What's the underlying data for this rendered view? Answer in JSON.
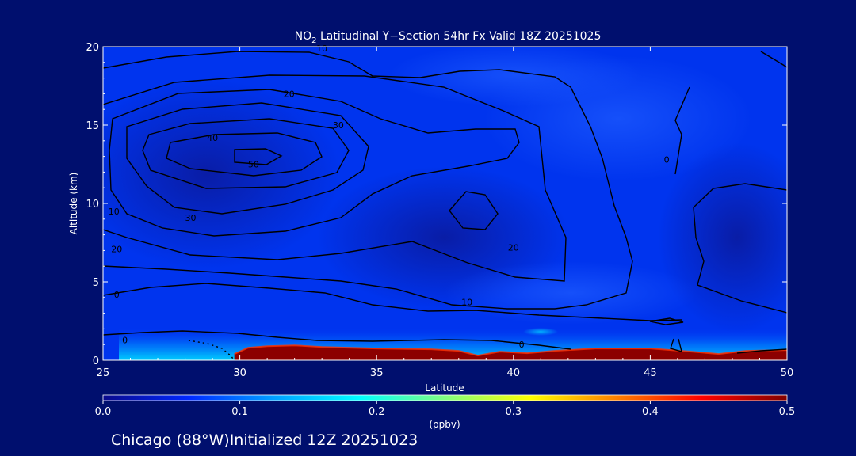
{
  "chart_data": {
    "type": "heatmap",
    "title": {
      "prefix": "NO",
      "subscript": "2",
      "suffix": " Latitudinal Y−Section 54hr  Fx Valid 18Z 20251025"
    },
    "xlabel": "Latitude",
    "ylabel": "Altitude (km)",
    "xlim": [
      25,
      50
    ],
    "ylim": [
      0,
      20
    ],
    "x_ticks": [
      25,
      30,
      35,
      40,
      45,
      50
    ],
    "y_ticks": [
      0,
      5,
      10,
      15,
      20
    ],
    "colorbar": {
      "min": 0.0,
      "max": 0.5,
      "ticks": [
        "0.0",
        "0.1",
        "0.2",
        "0.3",
        "0.4",
        "0.5"
      ],
      "units": "(ppbv)",
      "colors": [
        "#0a0a8c",
        "#0028ff",
        "#00a0ff",
        "#00ffff",
        "#80ff80",
        "#ffff00",
        "#ff8000",
        "#ff0000",
        "#800000"
      ]
    },
    "background_field": "mostly 0.02-0.08 ppbv (blue) aloft; high values (>0.5 ppbv, dark red) in a shallow layer 0-1 km between latitude 30 and 50",
    "surface_layer": [
      {
        "lat": 29.8,
        "top_km": 0.4
      },
      {
        "lat": 30.3,
        "top_km": 0.8
      },
      {
        "lat": 31.0,
        "top_km": 0.9
      },
      {
        "lat": 32.0,
        "top_km": 0.95
      },
      {
        "lat": 33.0,
        "top_km": 0.85
      },
      {
        "lat": 35.0,
        "top_km": 0.75
      },
      {
        "lat": 37.0,
        "top_km": 0.7
      },
      {
        "lat": 38.0,
        "top_km": 0.6
      },
      {
        "lat": 38.7,
        "top_km": 0.3
      },
      {
        "lat": 39.5,
        "top_km": 0.55
      },
      {
        "lat": 40.5,
        "top_km": 0.45
      },
      {
        "lat": 41.5,
        "top_km": 0.6
      },
      {
        "lat": 43.0,
        "top_km": 0.75
      },
      {
        "lat": 45.0,
        "top_km": 0.75
      },
      {
        "lat": 46.5,
        "top_km": 0.55
      },
      {
        "lat": 47.5,
        "top_km": 0.4
      },
      {
        "lat": 48.5,
        "top_km": 0.6
      },
      {
        "lat": 50.0,
        "top_km": 0.65
      }
    ],
    "contour_labels": [
      {
        "text": "10",
        "lat": 33.0,
        "alt": 19.9
      },
      {
        "text": "20",
        "lat": 31.8,
        "alt": 17.0
      },
      {
        "text": "30",
        "lat": 33.6,
        "alt": 15.0
      },
      {
        "text": "40",
        "lat": 29.0,
        "alt": 14.2
      },
      {
        "text": "50",
        "lat": 30.5,
        "alt": 12.5
      },
      {
        "text": "10",
        "lat": 25.4,
        "alt": 9.5
      },
      {
        "text": "30",
        "lat": 28.2,
        "alt": 9.1
      },
      {
        "text": "20",
        "lat": 25.5,
        "alt": 7.1
      },
      {
        "text": "0",
        "lat": 25.5,
        "alt": 4.2
      },
      {
        "text": "20",
        "lat": 40.0,
        "alt": 7.2
      },
      {
        "text": "10",
        "lat": 38.3,
        "alt": 3.7
      },
      {
        "text": "0",
        "lat": 45.6,
        "alt": 12.8
      },
      {
        "text": "0",
        "lat": 25.8,
        "alt": 1.3
      },
      {
        "text": "0",
        "lat": 40.3,
        "alt": 1.0
      }
    ]
  },
  "footer": {
    "location": "Chicago (88°W)Initialized 12Z 20251023"
  },
  "colors": {
    "page_background": "#000f6e",
    "contour_line": "#000000"
  }
}
